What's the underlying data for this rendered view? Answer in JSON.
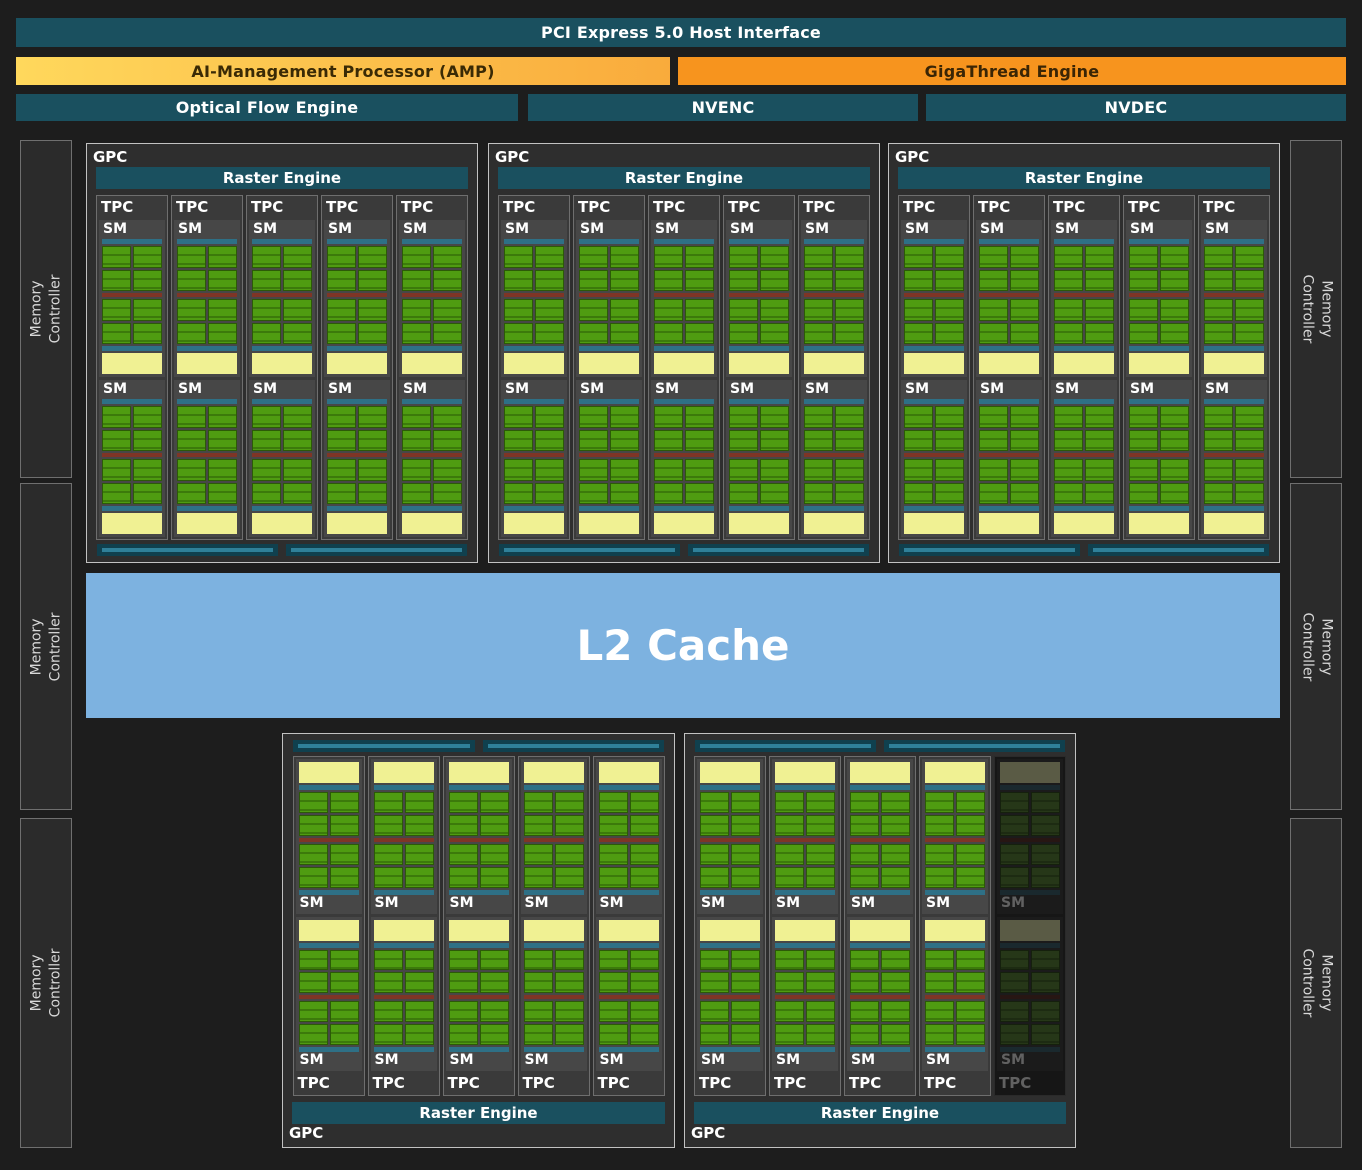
{
  "header_bars": {
    "pcie": "PCI Express 5.0 Host Interface",
    "amp": "AI-Management Processor (AMP)",
    "gigathread": "GigaThread Engine",
    "optical_flow": "Optical Flow Engine",
    "nvenc": "NVENC",
    "nvdec": "NVDEC"
  },
  "labels": {
    "gpc": "GPC",
    "tpc": "TPC",
    "sm": "SM",
    "raster_engine": "Raster Engine",
    "memory_controller": "Memory Controller",
    "l2_cache": "L2 Cache"
  },
  "structure": {
    "top_gpcs": 3,
    "bottom_gpcs": 2,
    "tpcs_per_gpc": 5,
    "sms_per_tpc": 2,
    "memory_controllers_per_side": 3,
    "disabled_tpc": {
      "bottom_gpc_index": 1,
      "tpc_index": 4
    }
  },
  "colors": {
    "background": "#1d1d1d",
    "teal_bar": "#1a505f",
    "amp_start": "#ffd85c",
    "amp_end": "#f9ab3c",
    "orange": "#f7941e",
    "l2_blue": "#7db2e0",
    "sm_green": "#4f9c11",
    "sm_yellow": "#f0f193",
    "sm_teal": "#2e7086",
    "sm_red": "#7e3526"
  }
}
